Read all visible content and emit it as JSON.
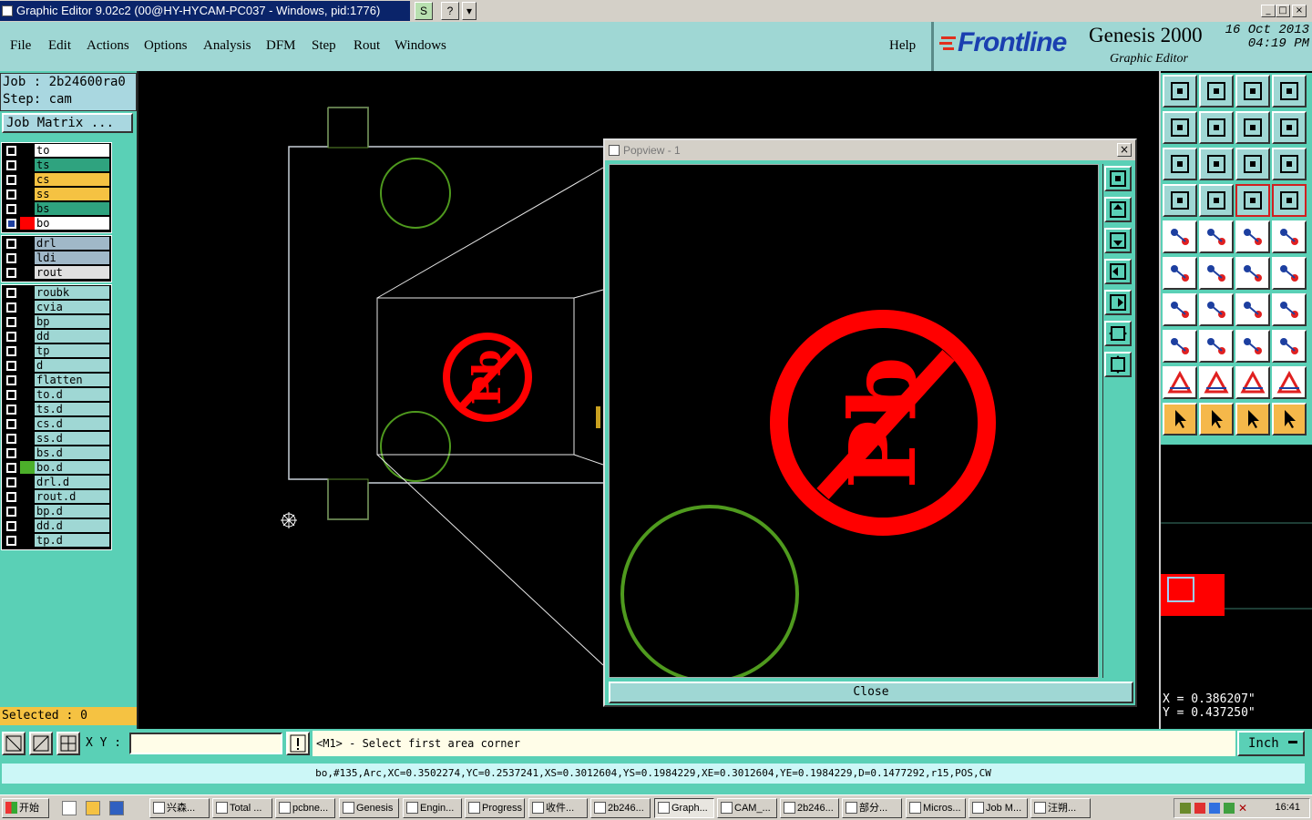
{
  "window": {
    "title": "Graphic Editor 9.02c2 (00@HY-HYCAM-PC037 - Windows, pid:1776)",
    "buttons": [
      "S",
      "?",
      "▾"
    ]
  },
  "menu": {
    "items": [
      "File",
      "Edit",
      "Actions",
      "Options",
      "Analysis",
      "DFM",
      "Step",
      "Rout",
      "Windows"
    ],
    "help": "Help"
  },
  "branding": {
    "logo": "Frontline",
    "product": "Genesis 2000",
    "subtitle": "Graphic Editor",
    "date_line1": "16 Oct 2013",
    "date_line2": "04:19 PM"
  },
  "job": {
    "job_label": "Job  : 2b24600ra0",
    "step_label": "Step: cam",
    "matrix_button": "Job Matrix ..."
  },
  "layers_group1": [
    {
      "name": "to",
      "color": "#ffffff",
      "swatch": "#000000",
      "arrow": "◂"
    },
    {
      "name": "ts",
      "color": "#2fa37f",
      "swatch": "#000000",
      "arrow": "◂"
    },
    {
      "name": "cs",
      "color": "#f5c242",
      "swatch": "#000000",
      "arrow": "◂"
    },
    {
      "name": "ss",
      "color": "#f5c242",
      "swatch": "#000000",
      "arrow": "◂"
    },
    {
      "name": "bs",
      "color": "#2fa37f",
      "swatch": "#000000",
      "arrow": "◂"
    },
    {
      "name": "bo",
      "color": "#ffffff",
      "swatch": "#ff0000",
      "arrow": "◂",
      "active": true
    }
  ],
  "layers_group2": [
    {
      "name": "drl",
      "color": "#a0b8c8",
      "swatch": "#000000",
      "arrow": ""
    },
    {
      "name": "ldi",
      "color": "#a0b8c8",
      "swatch": "#000000",
      "arrow": ""
    },
    {
      "name": "rout",
      "color": "#e0e0e0",
      "swatch": "#000000",
      "arrow": ""
    }
  ],
  "layers_group3": [
    {
      "name": "roubk",
      "color": "#9fd7d4",
      "swatch": "#000000",
      "arrow": ""
    },
    {
      "name": "cvia",
      "color": "#9fd7d4",
      "swatch": "#000000",
      "arrow": ""
    },
    {
      "name": "bp",
      "color": "#9fd7d4",
      "swatch": "#000000",
      "arrow": "◂"
    },
    {
      "name": "dd",
      "color": "#9fd7d4",
      "swatch": "#000000",
      "arrow": "◂"
    },
    {
      "name": "tp",
      "color": "#9fd7d4",
      "swatch": "#000000",
      "arrow": "◂"
    },
    {
      "name": "d",
      "color": "#9fd7d4",
      "swatch": "#000000",
      "arrow": ""
    },
    {
      "name": "flatten",
      "color": "#9fd7d4",
      "swatch": "#000000",
      "arrow": ""
    },
    {
      "name": "to.d",
      "color": "#9fd7d4",
      "swatch": "#000000",
      "arrow": "◂"
    },
    {
      "name": "ts.d",
      "color": "#9fd7d4",
      "swatch": "#000000",
      "arrow": "◂"
    },
    {
      "name": "cs.d",
      "color": "#9fd7d4",
      "swatch": "#000000",
      "arrow": "◂"
    },
    {
      "name": "ss.d",
      "color": "#9fd7d4",
      "swatch": "#000000",
      "arrow": "◂"
    },
    {
      "name": "bs.d",
      "color": "#9fd7d4",
      "swatch": "#000000",
      "arrow": "◂"
    },
    {
      "name": "bo.d",
      "color": "#9fd7d4",
      "swatch": "#4caf2a",
      "arrow": "◂"
    },
    {
      "name": "drl.d",
      "color": "#9fd7d4",
      "swatch": "#000000",
      "arrow": ""
    },
    {
      "name": "rout.d",
      "color": "#9fd7d4",
      "swatch": "#000000",
      "arrow": ""
    },
    {
      "name": "bp.d",
      "color": "#9fd7d4",
      "swatch": "#000000",
      "arrow": "◂"
    },
    {
      "name": "dd.d",
      "color": "#9fd7d4",
      "swatch": "#000000",
      "arrow": "◂"
    },
    {
      "name": "tp.d",
      "color": "#9fd7d4",
      "swatch": "#000000",
      "arrow": "◂"
    }
  ],
  "selected_label": "Selected : 0",
  "popview": {
    "title": "Popview - 1",
    "close_label": "Close"
  },
  "coords": {
    "x": "X  =  0.386207\"",
    "y": "Y  =  0.437250\""
  },
  "command": {
    "xy_label": "X Y :",
    "xy_value": "",
    "prompt": "<M1> - Select first area corner",
    "unit": "Inch",
    "status": "bo,#135,Arc,XC=0.3502274,YC=0.2537241,XS=0.3012604,YS=0.1984229,XE=0.3012604,YE=0.1984229,D=0.1477292,r15,POS,CW"
  },
  "colors": {
    "panel": "#5ad0b6",
    "menu": "#9fd7d4",
    "symbol_red": "#ff0000",
    "outline_green": "#4f9a1e"
  },
  "taskbar": {
    "start": "开始",
    "tasks": [
      "兴森...",
      "Total ...",
      "pcbne...",
      "Genesis",
      "Engin...",
      "Progress",
      "收件...",
      "2b246...",
      "Graph...",
      "CAM_...",
      "2b246...",
      "部分...",
      "Micros...",
      "Job M...",
      "汪朔..."
    ],
    "clock": "16:41"
  }
}
